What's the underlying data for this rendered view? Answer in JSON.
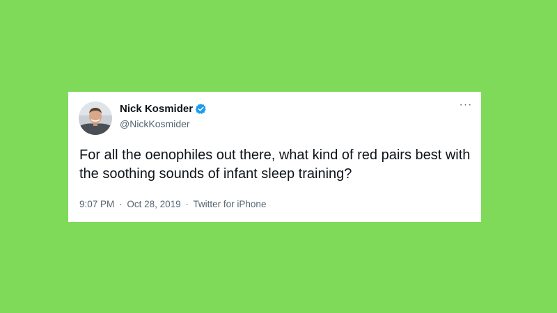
{
  "background_color": "#80da5a",
  "tweet": {
    "display_name": "Nick Kosmider",
    "handle": "@NickKosmider",
    "verified": true,
    "text": "For all the oenophiles out there, what kind of red pairs best with the soothing sounds of infant sleep training?",
    "time": "9:07 PM",
    "date": "Oct 28, 2019",
    "source": "Twitter for iPhone",
    "separator": "·",
    "more_icon": "···",
    "accent_color": "#1d9bf0"
  }
}
